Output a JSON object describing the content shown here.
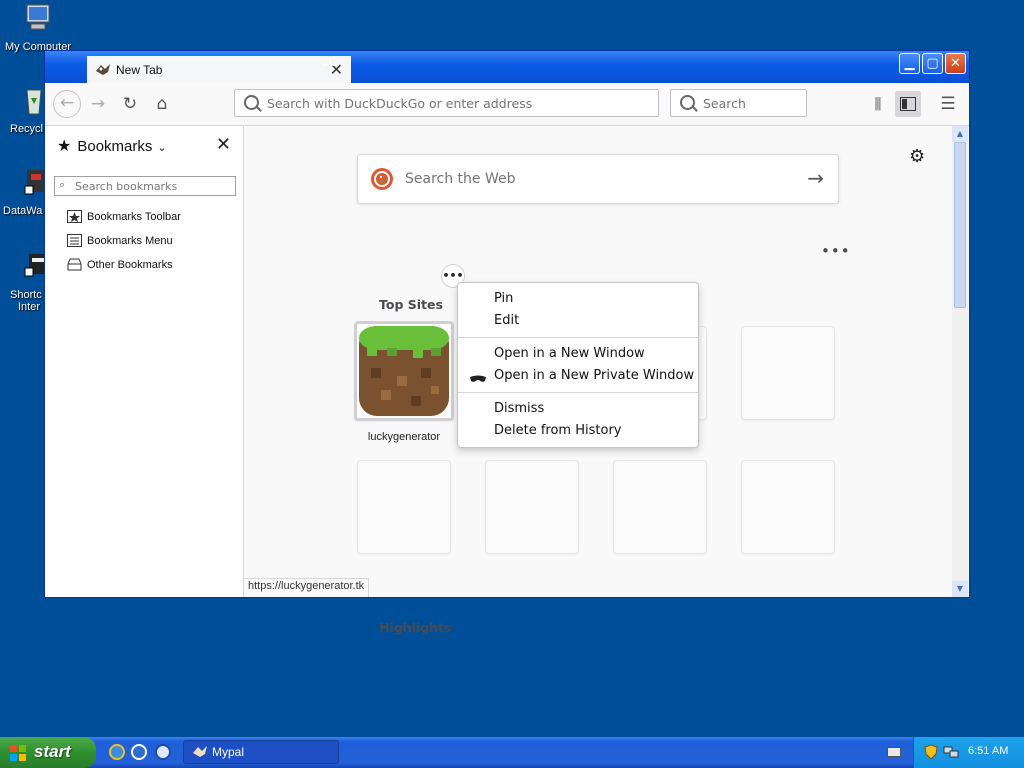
{
  "desktop": {
    "icons": [
      {
        "label": "My Computer"
      },
      {
        "label": "Recycl"
      },
      {
        "label": "DataWa"
      },
      {
        "label": "Shortc",
        "label2": "Inter"
      }
    ]
  },
  "browser": {
    "tab": {
      "title": "New Tab"
    },
    "urlbar": {
      "placeholder": "Search with DuckDuckGo or enter address"
    },
    "searchbar": {
      "placeholder": "Search"
    },
    "sidebar": {
      "title": "Bookmarks",
      "search_placeholder": "Search bookmarks",
      "items": [
        {
          "label": "Bookmarks Toolbar"
        },
        {
          "label": "Bookmarks Menu"
        },
        {
          "label": "Other Bookmarks"
        }
      ]
    },
    "newtab": {
      "websearch_placeholder": "Search the Web",
      "top_sites_title": "Top Sites",
      "highlights_title": "Highlights",
      "tiles": [
        {
          "label": "luckygenerator"
        }
      ]
    },
    "context_menu": {
      "items": [
        {
          "label": "Pin"
        },
        {
          "label": "Edit"
        },
        {
          "label": "Open in a New Window"
        },
        {
          "label": "Open in a New Private Window"
        },
        {
          "label": "Dismiss"
        },
        {
          "label": "Delete from History"
        }
      ]
    },
    "status_url": "https://luckygenerator.tk"
  },
  "taskbar": {
    "start_label": "start",
    "task_label": "Mypal",
    "clock": "6:51 AM"
  },
  "colors": {
    "desktop": "#004e98",
    "titlebar": "#0d5ce6",
    "accent": "#0a84ff",
    "start_green": "#2f8e2f"
  }
}
